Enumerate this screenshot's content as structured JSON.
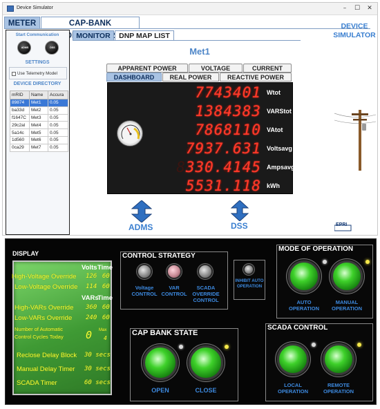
{
  "window": {
    "title": "Device Simulator",
    "controls": [
      "–",
      "☐",
      "✕"
    ]
  },
  "main_tabs": [
    {
      "label": "METER",
      "active": true
    },
    {
      "label": "CAP-BANK CONTROLLERS",
      "active": false
    }
  ],
  "left_panel": {
    "start_communication": "Start Communication",
    "buttons": [
      "ADMS",
      "DSS"
    ],
    "settings_label": "SETTINGS",
    "telemetry_label": "Use Telemetry Model",
    "telemetry_checked": false,
    "device_directory": "DEVICE DIRECTORY",
    "table": {
      "headers": [
        "mRID",
        "Name",
        "Accura"
      ],
      "rows": [
        [
          "89874",
          "Met1",
          "0.05"
        ],
        [
          "ba33d",
          "Met2",
          "0.05"
        ],
        [
          "f1647C",
          "Met3",
          "0.05"
        ],
        [
          "29c2al",
          "Met4",
          "0.05"
        ],
        [
          "5a14c",
          "Met5",
          "0.05"
        ],
        [
          "1d560",
          "Met6",
          "0.05"
        ],
        [
          "0ca29",
          "Met7",
          "0.05"
        ]
      ],
      "selected_row": 0
    }
  },
  "sub_tabs": [
    {
      "label": "MONITOR",
      "active": true
    },
    {
      "label": "DNP MAP LIST",
      "active": false
    }
  ],
  "meter_title": "Met1",
  "simulator_title": "DEVICE SIMULATOR",
  "meter_tabs_row1": [
    "APPARENT POWER",
    "VOLTAGE",
    "CURRENT"
  ],
  "meter_tabs_row2": [
    "DASHBOARD",
    "REAL POWER",
    "REACTIVE POWER"
  ],
  "meter_readings": [
    {
      "value": "7743401",
      "unit": "Wtot"
    },
    {
      "value": "1384383",
      "unit": "VARStot"
    },
    {
      "value": "7868110",
      "unit": "VAtot"
    },
    {
      "value": "7937.631",
      "unit": "Voltsavg"
    },
    {
      "value": "330.4145",
      "unit": "Ampsavg"
    },
    {
      "value": "5531.118",
      "unit": "kWh"
    }
  ],
  "arrows": {
    "adms": "ADMS",
    "dss": "DSS"
  },
  "logo_text": "EPRI",
  "display": {
    "title": "DISPLAY",
    "volts_header": "Volts",
    "time_header": "Time",
    "vars_header": "VARs",
    "rows": [
      {
        "label": "High-Voltage Override",
        "value": "126",
        "time": "60"
      },
      {
        "label": "Low-Voltage Override",
        "value": "114",
        "time": "60"
      },
      {
        "label": "High-VARs Override",
        "value": "360",
        "time": "60"
      },
      {
        "label": "Low-VARs Override",
        "value": "240",
        "time": "60"
      }
    ],
    "auto_cycles_label": "Number of Automatic Control Cycles Today",
    "auto_cycles_value": "0",
    "max_label": "Max",
    "max_value": "4",
    "timers": [
      {
        "label": "Reclose Delay Block",
        "value": "30 secs"
      },
      {
        "label": "Manual Delay Timer",
        "value": "30 secs"
      },
      {
        "label": "SCADA Timer",
        "value": "60 secs"
      }
    ]
  },
  "control_strategy": {
    "title": "CONTROL STRATEGY",
    "buttons": [
      "Voltage CONTROL",
      "VAR CONTROL",
      "SCADA OVERRIDE CONTROL"
    ],
    "inhibit": "INHIBIT AUTO OPERATION"
  },
  "mode_of_operation": {
    "title": "MODE OF OPERATION",
    "buttons": [
      "AUTO OPERATION",
      "MANUAL OPERATION"
    ]
  },
  "cap_bank_state": {
    "title": "CAP BANK STATE",
    "buttons": [
      "OPEN",
      "CLOSE"
    ]
  },
  "scada_control": {
    "title": "SCADA CONTROL",
    "buttons": [
      "LOCAL OPERATION",
      "REMOTE OPERATION"
    ]
  },
  "colors": {
    "accent_blue": "#3d8ae0",
    "lcd_red": "#ff3a2a",
    "display_green": "#3f9a34",
    "display_text": "#f2ff3a",
    "button_green": "#3ed12a",
    "led_yellow": "#f5e84a"
  }
}
